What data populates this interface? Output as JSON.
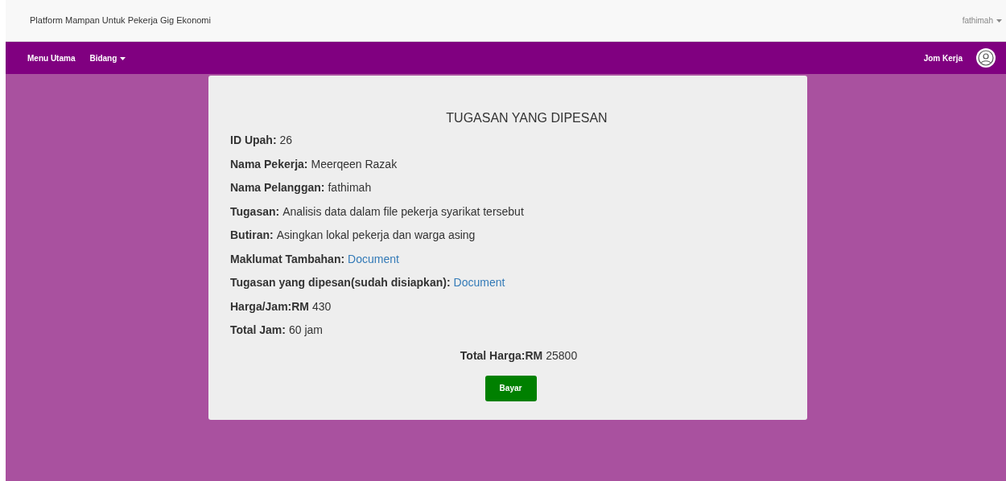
{
  "header": {
    "title": "Platform Mampan Untuk Pekerja Gig Ekonomi",
    "user_menu": "fathimah"
  },
  "navbar": {
    "left_items": [
      {
        "label": "Menu Utama",
        "dropdown": false
      },
      {
        "label": "Bidang",
        "dropdown": true
      }
    ],
    "right_item": "Jom Kerja"
  },
  "card": {
    "title": "TUGASAN YANG DIPESAN",
    "fields": [
      {
        "label": "ID Upah:",
        "value": "26",
        "kind": "text"
      },
      {
        "label": "Nama Pekerja:",
        "value": "Meerqeen Razak",
        "kind": "text"
      },
      {
        "label": "Nama Pelanggan:",
        "value": "fathimah",
        "kind": "text"
      },
      {
        "label": "Tugasan:",
        "value": "Analisis data dalam file pekerja syarikat tersebut",
        "kind": "text"
      },
      {
        "label": "Butiran:",
        "value": "Asingkan lokal pekerja dan warga asing",
        "kind": "text"
      },
      {
        "label": "Maklumat Tambahan:",
        "value": "Document",
        "kind": "link"
      },
      {
        "label": "Tugasan yang dipesan(sudah disiapkan):",
        "value": "Document",
        "kind": "link"
      },
      {
        "label": "Harga/Jam:RM",
        "value": "430",
        "kind": "text"
      },
      {
        "label": "Total Jam:",
        "value": "60 jam",
        "kind": "text"
      }
    ],
    "total": {
      "label": "Total Harga:RM",
      "value": "25800"
    },
    "button": "Bayar"
  }
}
